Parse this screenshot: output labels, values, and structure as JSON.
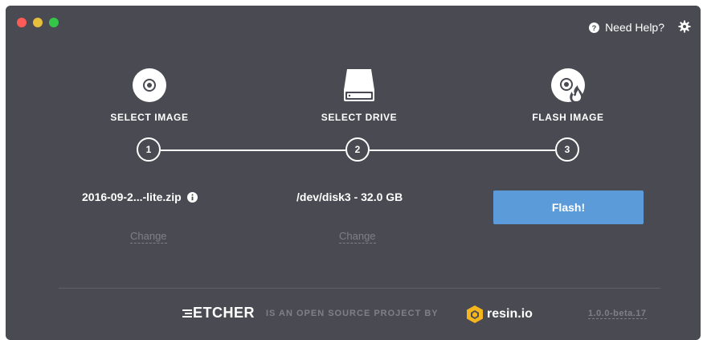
{
  "window": {
    "help_label": "Need Help?"
  },
  "steps": [
    {
      "title": "SELECT IMAGE",
      "number": "1",
      "selection": "2016-09-2...-lite.zip",
      "change_label": "Change",
      "icon": "disc-icon"
    },
    {
      "title": "SELECT DRIVE",
      "number": "2",
      "selection": "/dev/disk3 - 32.0 GB",
      "change_label": "Change",
      "icon": "drive-icon"
    },
    {
      "title": "FLASH IMAGE",
      "number": "3",
      "button_label": "Flash!",
      "icon": "flash-disc-icon"
    }
  ],
  "footer": {
    "logo_text": "ETCHER",
    "tagline": "IS AN OPEN SOURCE PROJECT BY",
    "company": "resin.io",
    "version": "1.0.0-beta.17"
  },
  "colors": {
    "background": "#4a4b52",
    "accent": "#5b9bd9",
    "muted": "#7e8088",
    "resin_logo": "#f5b51d"
  }
}
